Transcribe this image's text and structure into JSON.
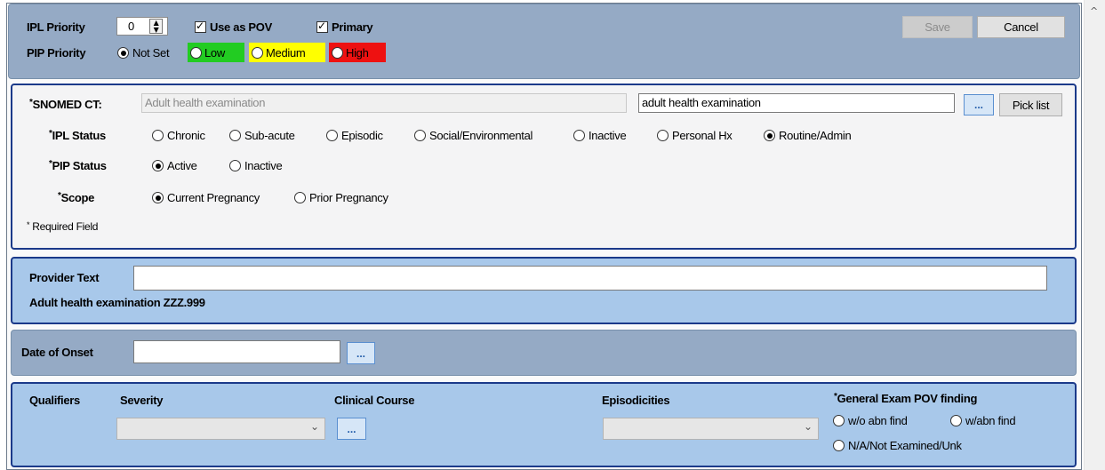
{
  "top": {
    "ipl_priority_label": "IPL Priority",
    "ipl_priority_value": "0",
    "use_as_pov_label": "Use as POV",
    "use_as_pov_checked": true,
    "primary_label": "Primary",
    "primary_checked": true,
    "pip_priority_label": "PIP Priority",
    "pip_options": [
      {
        "label": "Not Set",
        "selected": true,
        "color": ""
      },
      {
        "label": "Low",
        "selected": false,
        "color": "#22cc22"
      },
      {
        "label": "Medium",
        "selected": false,
        "color": "#ffff00"
      },
      {
        "label": "High",
        "selected": false,
        "color": "#ee1111"
      }
    ],
    "save_label": "Save",
    "cancel_label": "Cancel"
  },
  "snomed": {
    "snomed_label": "SNOMED CT:",
    "snomed_value": "Adult health examination",
    "search_value": "adult health examination",
    "ellipsis_label": "...",
    "pick_list_label": "Pick list",
    "ipl_status_label": "IPL Status",
    "ipl_status_options": [
      "Chronic",
      "Sub-acute",
      "Episodic",
      "Social/Environmental",
      "Inactive",
      "Personal Hx",
      "Routine/Admin"
    ],
    "ipl_status_selected": "Routine/Admin",
    "pip_status_label": "PIP Status",
    "pip_status_options": [
      "Active",
      "Inactive"
    ],
    "pip_status_selected": "Active",
    "scope_label": "Scope",
    "scope_options": [
      "Current Pregnancy",
      "Prior Pregnancy"
    ],
    "scope_selected": "Current Pregnancy",
    "required_note": "Required Field",
    "required_mark": "*"
  },
  "provider": {
    "provider_text_label": "Provider Text",
    "provider_text_value": "",
    "diagnosis_text": "Adult health examination  ZZZ.999"
  },
  "onset": {
    "date_of_onset_label": "Date of Onset",
    "date_value": "",
    "ellipsis_label": "..."
  },
  "qualifiers": {
    "qualifiers_label": "Qualifiers",
    "severity_label": "Severity",
    "severity_value": "",
    "clinical_course_label": "Clinical Course",
    "ellipsis_label": "...",
    "episodicities_label": "Episodicities",
    "episodicities_value": "",
    "general_exam_label": "General Exam POV finding",
    "general_exam_options": [
      "w/o abn find",
      "w/abn find",
      "N/A/Not Examined/Unk"
    ]
  }
}
